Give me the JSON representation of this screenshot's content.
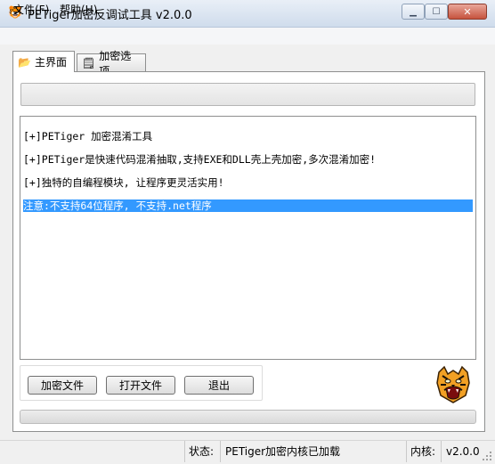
{
  "window": {
    "title": "PETiger加密反调试工具 v2.0.0",
    "icon": "tiger-icon",
    "buttons": [
      "minimize",
      "maximize",
      "close"
    ]
  },
  "menu": {
    "items": [
      {
        "label": "文件(F)"
      },
      {
        "label": "帮助(H)"
      }
    ]
  },
  "tabs": [
    {
      "label": "主界面",
      "icon": "folder-open-icon",
      "active": true
    },
    {
      "label": "加密选项",
      "icon": "settings-page-icon",
      "active": false
    }
  ],
  "main": {
    "path_value": "",
    "log": [
      {
        "text": "[+]PETiger 加密混淆工具",
        "selected": false
      },
      {
        "text": "[+]PETiger是快速代码混淆抽取,支持EXE和DLL壳上壳加密,多次混淆加密!",
        "selected": false
      },
      {
        "text": "[+]独特的自编程模块, 让程序更灵活实用!",
        "selected": false
      },
      {
        "text": "注意:不支持64位程序, 不支持.net程序",
        "selected": true
      }
    ],
    "buttons": {
      "encrypt": "加密文件",
      "open": "打开文件",
      "exit": "退出"
    },
    "progress": 0
  },
  "status": {
    "label": "状态:",
    "value": "PETiger加密内核已加载",
    "kernel_label": "内核:",
    "kernel_value": "v2.0.0"
  },
  "colors": {
    "selection": "#3399ff",
    "titlebar": "#dbe6f4",
    "close_button": "#c6533d"
  }
}
